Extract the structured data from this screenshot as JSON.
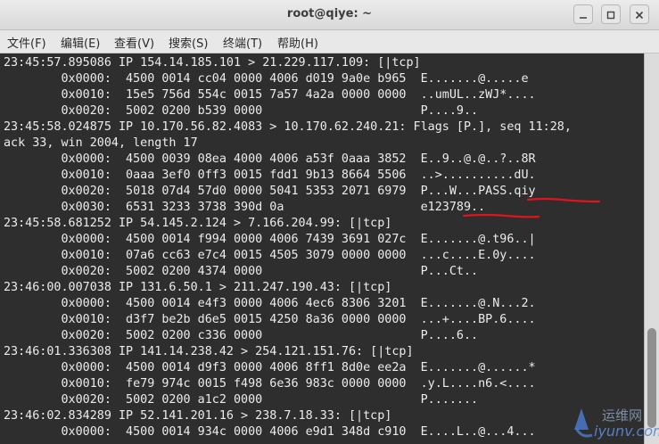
{
  "window": {
    "title": "root@qiye: ~"
  },
  "menu": {
    "items": [
      "文件(F)",
      "编辑(E)",
      "查看(V)",
      "搜索(S)",
      "终端(T)",
      "帮助(H)"
    ]
  },
  "terminal": {
    "lines": [
      "23:45:57.895086 IP 154.14.185.101 > 21.229.117.109: [|tcp]",
      "        0x0000:  4500 0014 cc04 0000 4006 d019 9a0e b965  E.......@.....e",
      "        0x0010:  15e5 756d 554c 0015 7a57 4a2a 0000 0000  ..umUL..zWJ*....",
      "        0x0020:  5002 0200 b539 0000                      P....9..",
      "23:45:58.024875 IP 10.170.56.82.4083 > 10.170.62.240.21: Flags [P.], seq 11:28,",
      "ack 33, win 2004, length 17",
      "        0x0000:  4500 0039 08ea 4000 4006 a53f 0aaa 3852  E..9..@.@..?..8R",
      "        0x0010:  0aaa 3ef0 0ff3 0015 fdd1 9b13 8664 5506  ..>..........dU.",
      "        0x0020:  5018 07d4 57d0 0000 5041 5353 2071 6979  P...W...PASS.qiy",
      "        0x0030:  6531 3233 3738 390d 0a                   e123789..",
      "23:45:58.681252 IP 54.145.2.124 > 7.166.204.99: [|tcp]",
      "        0x0000:  4500 0014 f994 0000 4006 7439 3691 027c  E.......@.t96..|",
      "        0x0010:  07a6 cc63 e7c4 0015 4505 3079 0000 0000  ...c....E.0y....",
      "        0x0020:  5002 0200 4374 0000                      P...Ct..",
      "23:46:00.007038 IP 131.6.50.1 > 211.247.190.43: [|tcp]",
      "        0x0000:  4500 0014 e4f3 0000 4006 4ec6 8306 3201  E.......@.N...2.",
      "        0x0010:  d3f7 be2b d6e5 0015 4250 8a36 0000 0000  ...+....BP.6....",
      "        0x0020:  5002 0200 c336 0000                      P....6..",
      "23:46:01.336308 IP 141.14.238.42 > 254.121.151.76: [|tcp]",
      "        0x0000:  4500 0014 d9f3 0000 4006 8ff1 8d0e ee2a  E.......@......*",
      "        0x0010:  fe79 974c 0015 f498 6e36 983c 0000 0000  .y.L....n6.<....",
      "        0x0020:  5002 0200 a1c2 0000                      P.......",
      "23:46:02.834289 IP 52.141.201.16 > 238.7.18.33: [|tcp]",
      "        0x0000:  4500 0014 934c 0000 4006 e9d1 348d c910  E....L..@...4..."
    ]
  },
  "watermark": {
    "line1": "运维网",
    "line2": "iyunv.com"
  },
  "colors": {
    "terminal_bg": "#2e2e2e",
    "terminal_fg": "#ececec",
    "annotation": "#e0141e"
  },
  "icons": {
    "minimize": "minimize-icon",
    "maximize": "maximize-icon",
    "close": "close-icon"
  }
}
